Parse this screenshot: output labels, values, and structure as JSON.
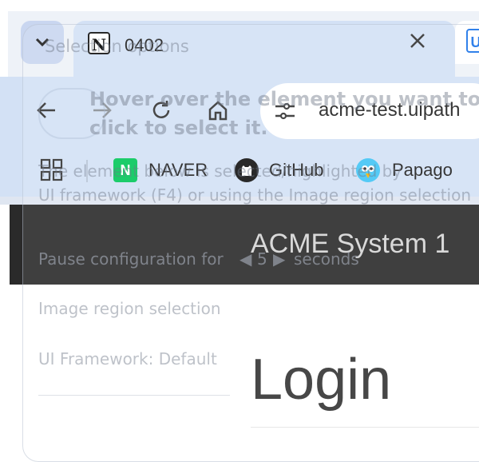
{
  "browser": {
    "tab_menu_icon": "chevron-down-icon",
    "active_tab": {
      "title": "0402",
      "favicon": "N"
    },
    "next_tab_favicon": "U",
    "close_icon": "close-icon",
    "toolbar": {
      "back_icon": "back-arrow-icon",
      "forward_icon": "forward-arrow-icon",
      "reload_icon": "reload-icon",
      "home_icon": "home-icon",
      "site_info_icon": "tune-icon",
      "url": "acme-test.uipath"
    },
    "bookmarks": [
      {
        "label": "NAVER",
        "icon": "naver-icon",
        "glyph": "N"
      },
      {
        "label": "GitHub",
        "icon": "github-icon"
      },
      {
        "label": "Papago",
        "icon": "papago-icon"
      }
    ]
  },
  "overlay": {
    "title": "Selection options",
    "heading_line1": "Hover over the element you want to i",
    "heading_line2": "click to select it.",
    "desc_line1": "The element below is selected/highlighted by",
    "desc_line2": "UI framework (F4) or using the Image region selection",
    "pause_prefix": "Pause configuration for",
    "pause_value": "5",
    "pause_suffix": "seconds",
    "image_region": "Image region selection",
    "framework": "UI Framework: Default"
  },
  "page": {
    "app_title": "ACME System 1",
    "heading": "Login"
  },
  "colors": {
    "chrome_bg": "#d3e1f5",
    "header_bg": "#2a2a2a",
    "accent": "#1a73e8",
    "naver_green": "#03c75a"
  }
}
